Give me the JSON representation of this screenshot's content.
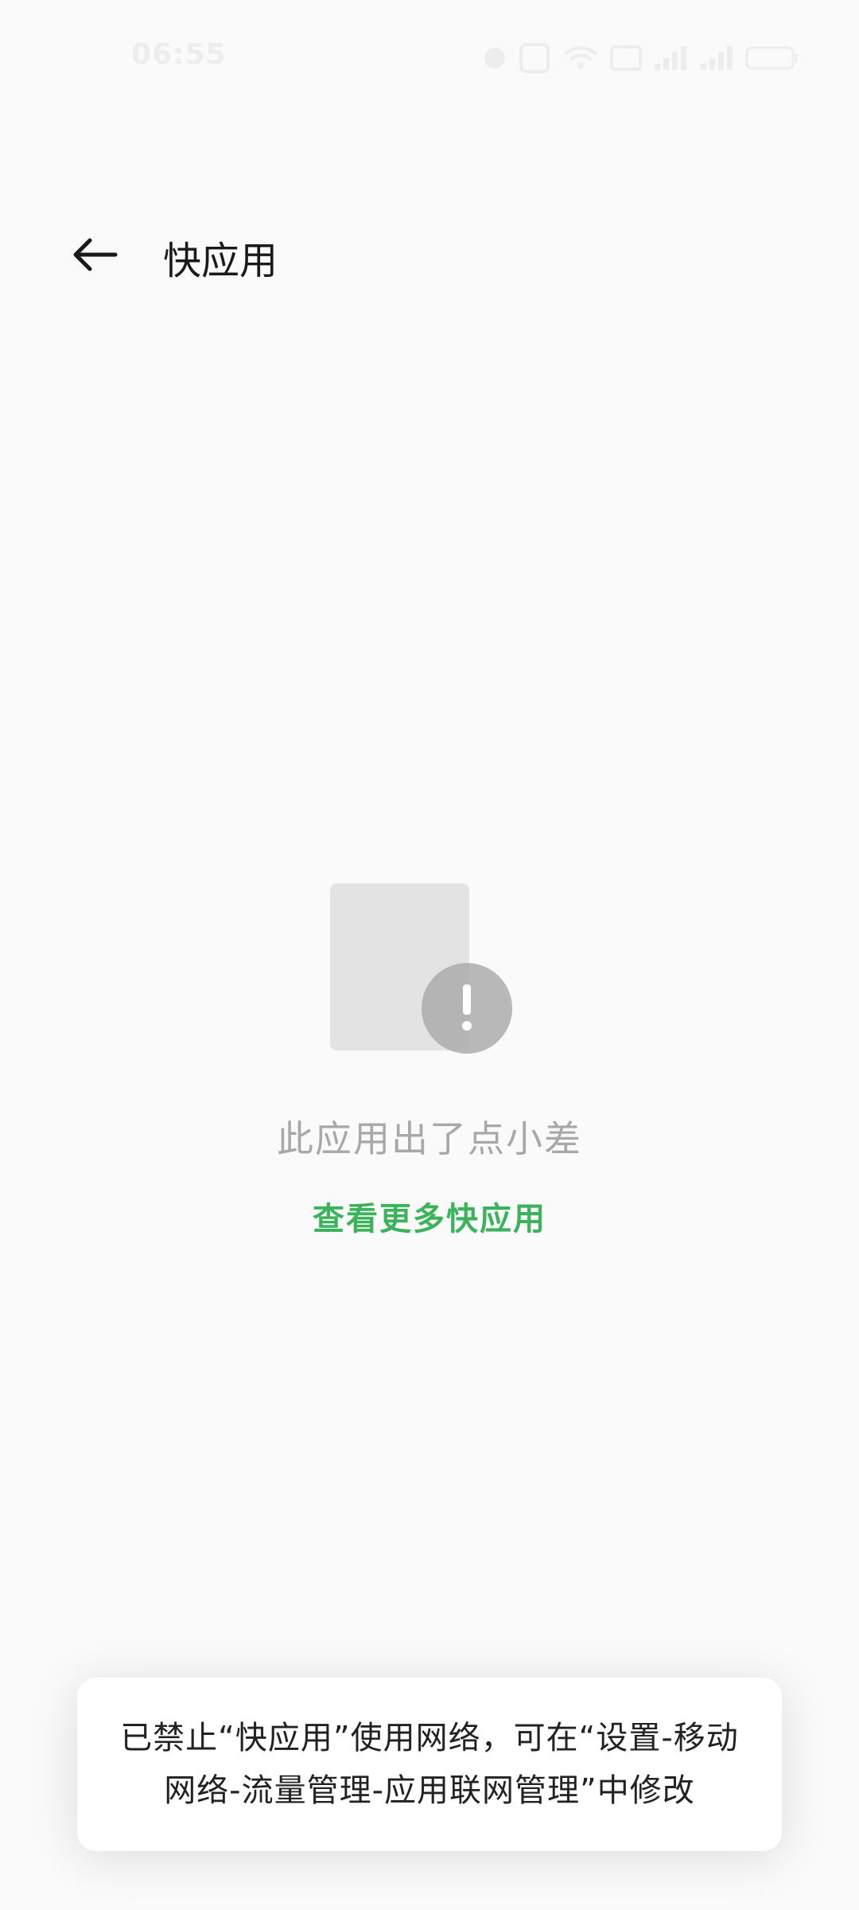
{
  "status_bar": {
    "time": "06:55",
    "icons": [
      "location-icon",
      "nfc-icon",
      "wifi-icon",
      "network-type-icon",
      "signal-icon",
      "signal-icon",
      "battery-icon"
    ]
  },
  "header": {
    "title": "快应用"
  },
  "error_state": {
    "message": "此应用出了点小差",
    "link_label": "查看更多快应用",
    "link_color": "#3ab35a"
  },
  "toast": {
    "line1": "已禁止“快应用”使用网络，可在“设置-移动",
    "line2": "网络-流量管理-应用联网管理”中修改"
  }
}
